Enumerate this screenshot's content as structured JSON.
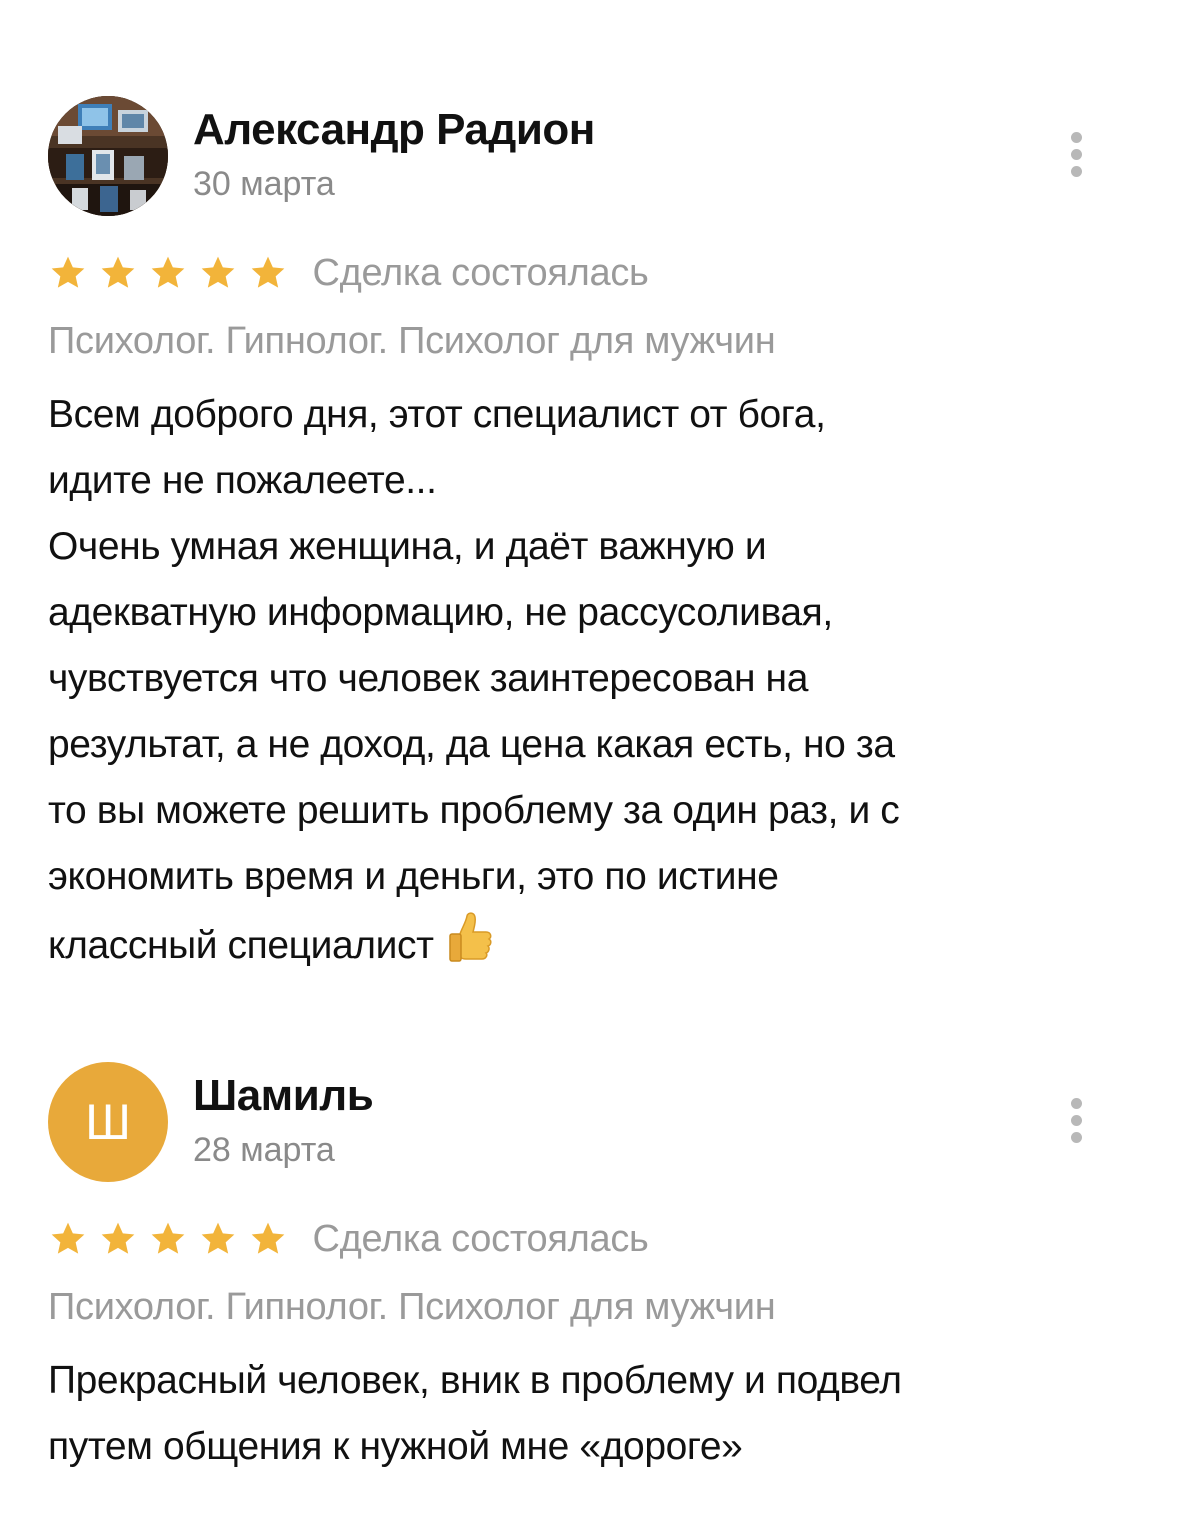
{
  "reviews": [
    {
      "author": "Александр Радион",
      "date": "30 марта",
      "avatar": {
        "type": "photo"
      },
      "rating": 5,
      "deal_status": "Сделка состоялась",
      "category": "Психолог. Гипнолог. Психолог для мужчин",
      "text": "Всем доброго дня, этот специалист от бога,\nидите не пожалеете...\nОчень умная женщина, и даёт важную и\nадекватную информацию, не рассусоливая,\nчувствуется что человек заинтересован на\nрезультат, а не доход, да цена какая есть, но за\nто вы можете решить проблему за один раз, и с\nэкономить время и деньги, это по истине\nклассный специалист",
      "emoji": "thumbs-up-icon"
    },
    {
      "author": "Шамиль",
      "date": "28 марта",
      "avatar": {
        "type": "letter",
        "letter": "Ш",
        "color": "#e8a93a"
      },
      "rating": 5,
      "deal_status": "Сделка состоялась",
      "category": "Психолог. Гипнолог. Психолог для мужчин",
      "text": "Прекрасный человек, вник в проблему и подвел\nпутем общения к нужной мне «дороге»"
    }
  ],
  "colors": {
    "star": "#f2b43a",
    "secondary_text": "#9a9a9a",
    "primary_text": "#111111"
  }
}
